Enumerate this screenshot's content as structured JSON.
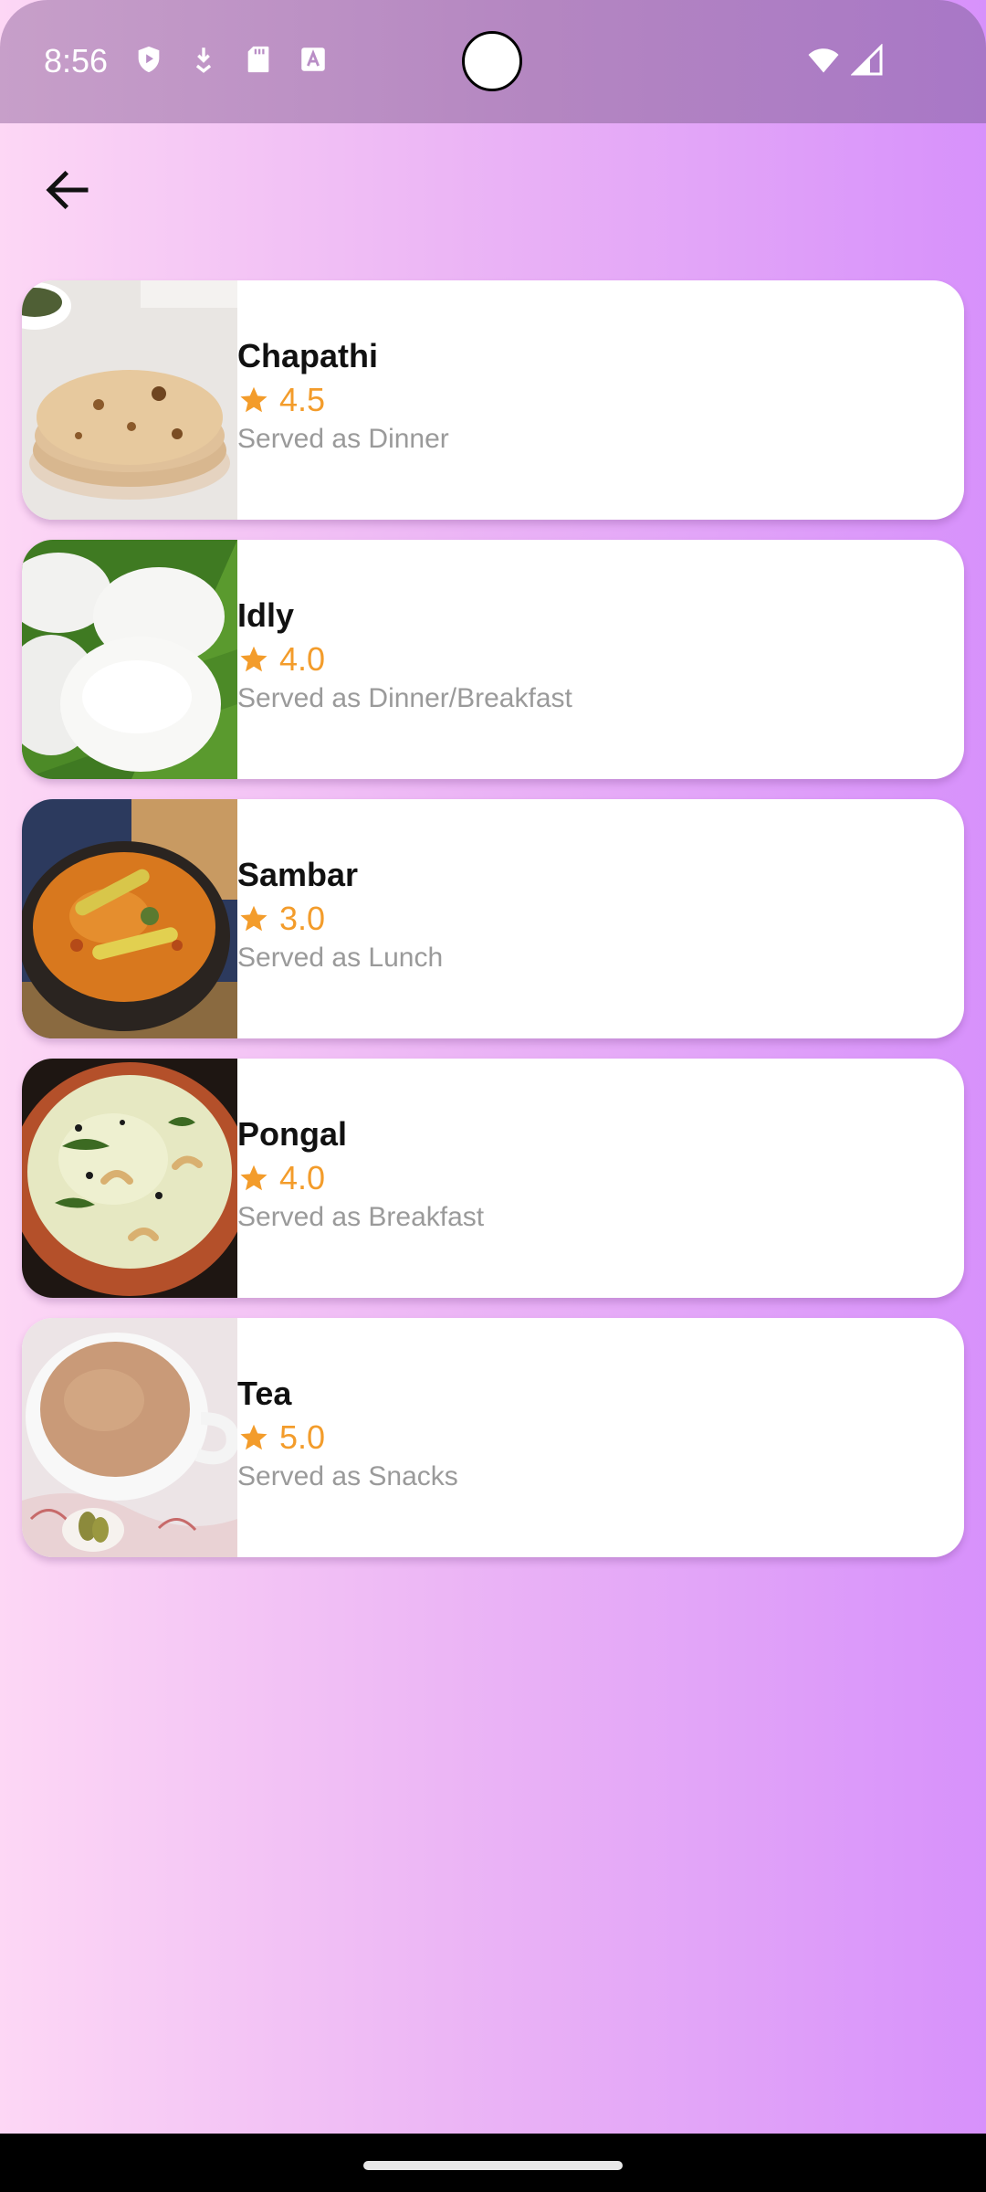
{
  "status_bar": {
    "time": "8:56",
    "left_icons": [
      "play-protect-icon",
      "download-icon",
      "sd-card-icon",
      "font-icon"
    ],
    "right_icons": [
      "wifi-icon",
      "signal-icon"
    ]
  },
  "header": {
    "back_icon": "arrow-left-icon"
  },
  "items": [
    {
      "name": "Chapathi",
      "rating": "4.5",
      "served": "Served as Dinner",
      "image": "chapathi-image"
    },
    {
      "name": "Idly",
      "rating": "4.0",
      "served": "Served as Dinner/Breakfast",
      "image": "idly-image"
    },
    {
      "name": "Sambar",
      "rating": "3.0",
      "served": "Served as Lunch",
      "image": "sambar-image"
    },
    {
      "name": "Pongal",
      "rating": "4.0",
      "served": "Served as Breakfast",
      "image": "pongal-image"
    },
    {
      "name": "Tea",
      "rating": "5.0",
      "served": "Served as Snacks",
      "image": "tea-image"
    }
  ],
  "colors": {
    "rating": "#f39c2b",
    "served_text": "#9a9a9a",
    "background_start": "#fdd7f5",
    "background_end": "#d791fb"
  }
}
